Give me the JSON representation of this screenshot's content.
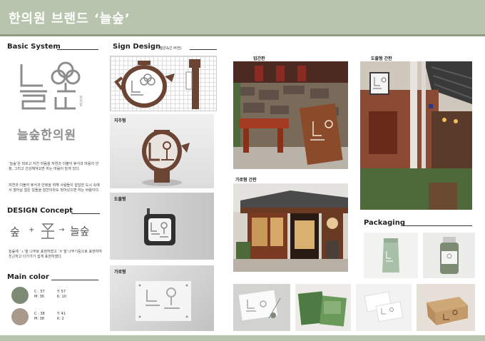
{
  "header": {
    "title": "한의원 브랜드 ‘늘숲’"
  },
  "basic_system": {
    "title": "Basic System",
    "logo_vertical_text": "늘숲",
    "logo_vertical_small": "한의원",
    "logo_horizontal_text": "늘숲한의원",
    "desc1": "‘늘숲’은 머르고 지친 마음을 자연과 더불어 휴식과 마음의 안정, 그리고 건강해져오면 하는 마음이 담게 있다.",
    "desc2": "자연과 더불어 휴식과 안정을 취해 사람들이 답답한 도시 속에서 떨어날 힘든 일들을 잠깐이라도 벗어났으면 하는 바람이다."
  },
  "design_concept": {
    "title": "DESIGN Concept",
    "glyph1": "숲",
    "plus": "+",
    "arrow": "→",
    "glyph3": "늘숲",
    "desc": "늘숲에 ‘ㅅ’을 나무로 표현하였고 ‘ㅎ’을 나무기둥으로 표현하여 친근하고 다가가기 쉽게 표현하였다."
  },
  "main_color": {
    "title": "Main color",
    "colors": [
      {
        "hex": "#7d8b74",
        "c": "C : 57",
        "y": "Y: 57",
        "m": "M: 36",
        "k": "K: 10"
      },
      {
        "hex": "#a99a8e",
        "c": "C : 38",
        "y": "Y: 41",
        "m": "M: 38",
        "k": "K: 2"
      }
    ]
  },
  "sign_design": {
    "title": "Sign Design",
    "subtitle": "(짙은&긴 버전)",
    "label_jiju": "지주형",
    "label_dolchul": "도출형",
    "label_garo": "가로형"
  },
  "photos": {
    "label_entrance": "입간판",
    "label_garo_sign": "가로형 간판",
    "label_dolchul_sign": "도출형 간판"
  },
  "packaging": {
    "title": "Packaging"
  },
  "colors": {
    "banner": "#b8c4ae",
    "sign_brown": "#6b4434",
    "logo_gray": "#9a9a9a"
  }
}
